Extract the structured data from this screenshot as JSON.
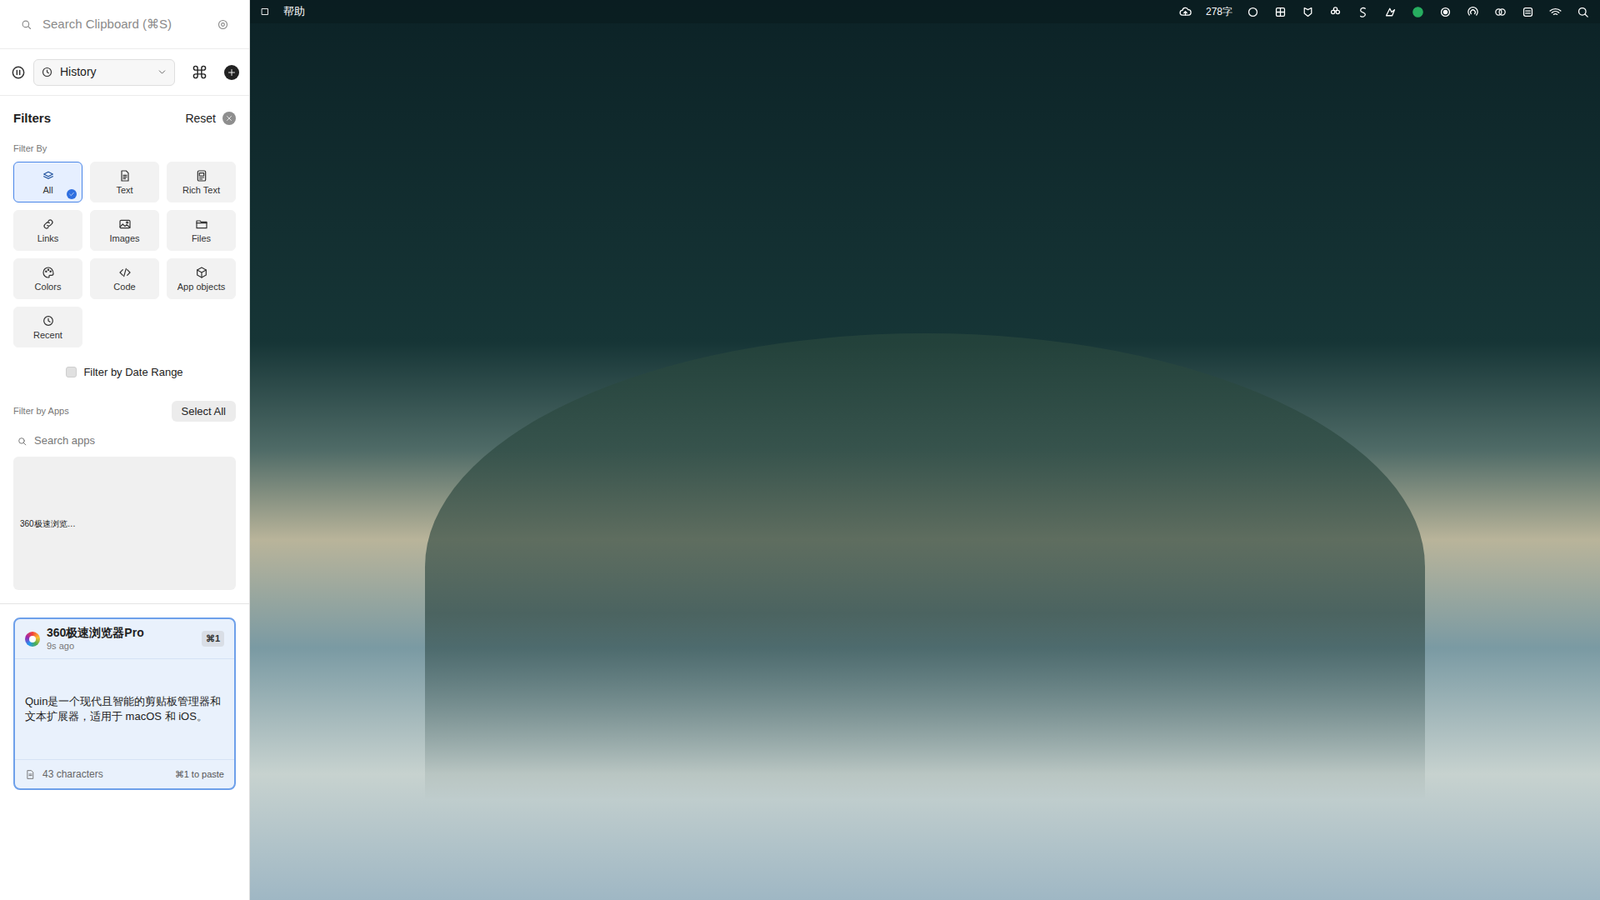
{
  "menu_bar": {
    "app_menu": "帮助",
    "word_count": "278字"
  },
  "search": {
    "placeholder": "Search Clipboard (⌘S)"
  },
  "toolbar": {
    "view": "History"
  },
  "filters": {
    "title": "Filters",
    "reset": "Reset",
    "filter_by_label": "Filter By",
    "types": [
      {
        "label": "All",
        "selected": true
      },
      {
        "label": "Text",
        "selected": false
      },
      {
        "label": "Rich Text",
        "selected": false
      },
      {
        "label": "Links",
        "selected": false
      },
      {
        "label": "Images",
        "selected": false
      },
      {
        "label": "Files",
        "selected": false
      },
      {
        "label": "Colors",
        "selected": false
      },
      {
        "label": "Code",
        "selected": false
      },
      {
        "label": "App objects",
        "selected": false
      },
      {
        "label": "Recent",
        "selected": false
      }
    ],
    "date_range": {
      "label": "Filter by Date Range",
      "checked": false
    },
    "apps_label": "Filter by Apps",
    "select_all": "Select All",
    "apps_search_placeholder": "Search apps",
    "apps": [
      {
        "label": "360极速浏览…",
        "selected": false
      }
    ]
  },
  "clips": [
    {
      "app": "360极速浏览器Pro",
      "time": "9s ago",
      "shortcut": "⌘1",
      "text": "Quin是一个现代且智能的剪贴板管理器和文本扩展器，适用于 macOS 和 iOS。",
      "count": "43 characters",
      "hint": "⌘1 to paste",
      "selected": true
    }
  ]
}
